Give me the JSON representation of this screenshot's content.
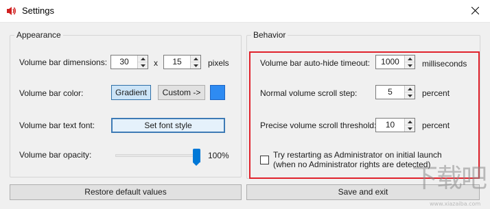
{
  "window": {
    "title": "Settings"
  },
  "appearance": {
    "title": "Appearance",
    "dimensions": {
      "label": "Volume bar dimensions:",
      "width": "30",
      "separator": "x",
      "height": "15",
      "unit": "pixels"
    },
    "color": {
      "label": "Volume bar color:",
      "gradient_button": "Gradient",
      "custom_button": "Custom ->",
      "swatch_color": "#2e8bf2"
    },
    "font": {
      "label": "Volume bar text font:",
      "button": "Set font style"
    },
    "opacity": {
      "label": "Volume bar opacity:",
      "value_text": "100%",
      "value": 100
    }
  },
  "behavior": {
    "title": "Behavior",
    "autohide": {
      "label": "Volume bar auto-hide timeout:",
      "value": "1000",
      "unit": "milliseconds"
    },
    "normal_step": {
      "label": "Normal volume scroll step:",
      "value": "5",
      "unit": "percent"
    },
    "precise": {
      "label": "Precise volume scroll threshold:",
      "value": "10",
      "unit": "percent"
    },
    "admin": {
      "line1": "Try restarting as Administrator on initial launch",
      "line2": "(when no Administrator rights are detected)",
      "checked": false
    },
    "highlight_color": "#e0202a"
  },
  "footer": {
    "restore_button": "Restore default values",
    "save_button": "Save and exit"
  },
  "watermark": {
    "text": "下载吧",
    "url": "www.xiazaiba.com"
  }
}
